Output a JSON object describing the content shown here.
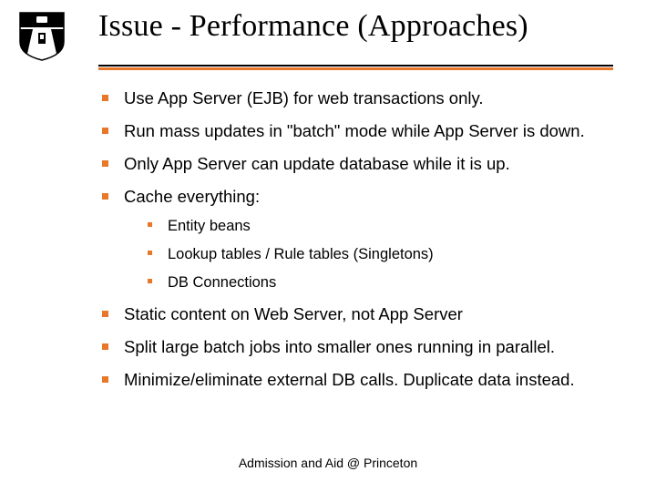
{
  "colors": {
    "accent": "#e8772a"
  },
  "title": "Issue - Performance (Approaches)",
  "bullets": {
    "b1": "Use App Server (EJB) for web transactions only.",
    "b2": "Run mass updates in \"batch\" mode while App Server is down.",
    "b3": "Only App Server can update database while it is up.",
    "b4": "Cache everything:",
    "b4_sub": {
      "s1": "Entity beans",
      "s2": "Lookup tables / Rule tables (Singletons)",
      "s3": "DB Connections"
    },
    "b5": "Static content on Web Server, not App Server",
    "b6": "Split large batch jobs into smaller ones running in parallel.",
    "b7": "Minimize/eliminate external DB calls.  Duplicate data instead."
  },
  "footer": "Admission and Aid @ Princeton"
}
